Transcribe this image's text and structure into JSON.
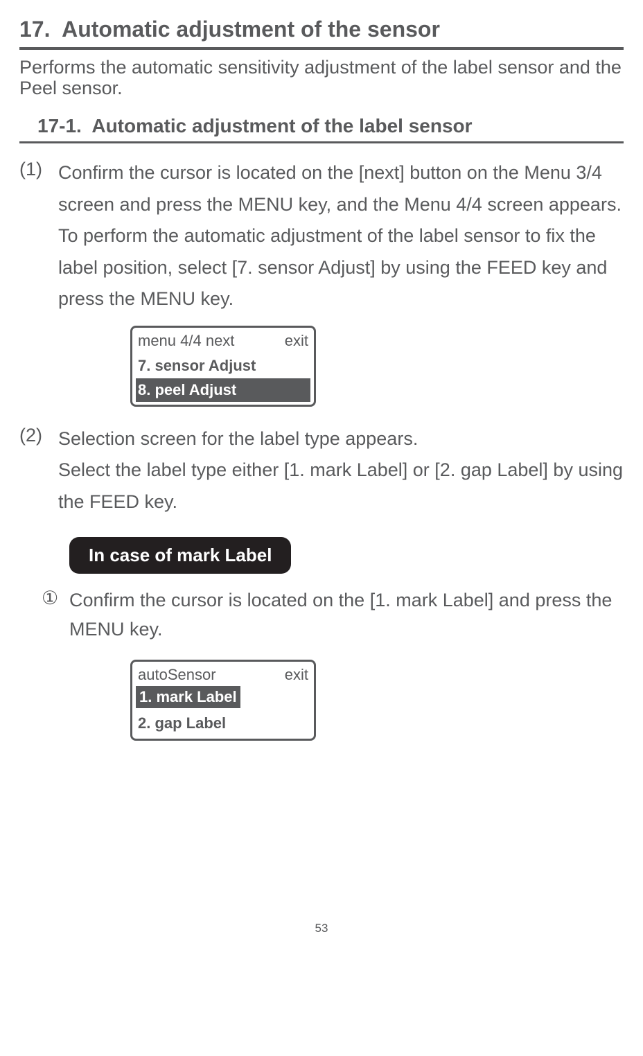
{
  "section": {
    "number": "17.",
    "title": "Automatic adjustment of the sensor"
  },
  "intro": "Performs the automatic sensitivity adjustment of the label sensor and the Peel sensor.",
  "subsection": {
    "number": "17-1.",
    "title": "Automatic adjustment of the label sensor"
  },
  "steps": {
    "s1": {
      "num": "(1)",
      "text": "Confirm the cursor is located on the [next] button on the Menu 3/4 screen and press the MENU key, and the Menu 4/4 screen appears. To perform the automatic adjustment of the label sensor to fix the label position, select [7. sensor Adjust] by using the FEED key and press the MENU key."
    },
    "s2": {
      "num": "(2)",
      "text_line1": "Selection screen for the label type appears.",
      "text_line2": "Select the label type either [1. mark Label] or [2. gap Label] by using the FEED key."
    }
  },
  "lcd1": {
    "row1_left": "menu 4/4 next",
    "row1_right": "exit",
    "row2": "7. sensor Adjust",
    "row3": "8. peel Adjust"
  },
  "case_label": "In case of mark Label",
  "circled": {
    "num": "①",
    "text": "Confirm the cursor is located on the  [1. mark Label] and press the MENU key."
  },
  "lcd2": {
    "row1_left": "autoSensor",
    "row1_right": "exit",
    "row2": "1. mark Label",
    "row3": "2. gap Label"
  },
  "page_number": "53"
}
